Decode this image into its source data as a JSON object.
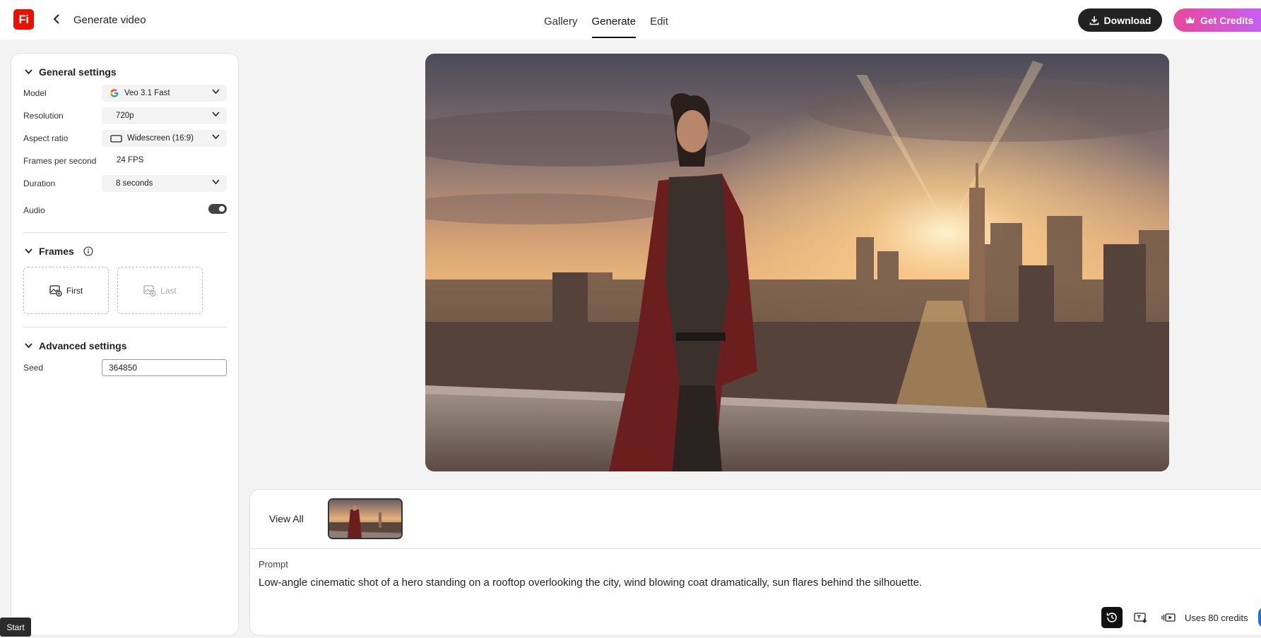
{
  "header": {
    "logo_text": "Fi",
    "page_title": "Generate video",
    "tabs": [
      {
        "label": "Gallery"
      },
      {
        "label": "Generate"
      },
      {
        "label": "Edit"
      }
    ],
    "download_label": "Download",
    "credits_label": "Get Credits"
  },
  "general": {
    "title": "General settings",
    "model_label": "Model",
    "model_value": "Veo 3.1 Fast",
    "resolution_label": "Resolution",
    "resolution_value": "720p",
    "aspect_label": "Aspect ratio",
    "aspect_value": "Widescreen (16:9)",
    "fps_label": "Frames per second",
    "fps_value": "24 FPS",
    "duration_label": "Duration",
    "duration_value": "8 seconds",
    "audio_label": "Audio",
    "audio_on": true
  },
  "frames": {
    "title": "Frames",
    "first_label": "First",
    "last_label": "Last"
  },
  "advanced": {
    "title": "Advanced settings",
    "seed_label": "Seed",
    "seed_value": "364850"
  },
  "start_label": "Start",
  "bottom": {
    "view_all_label": "View All",
    "prompt_label": "Prompt",
    "prompt_text": "Low-angle cinematic shot of a hero standing on a rooftop overlooking the city, wind blowing coat dramatically, sun flares behind the silhouette.",
    "credits_text": "Uses 80 credits"
  },
  "colors": {
    "brand_red": "#eb1000",
    "accent_pink": "#e8479b",
    "accent_purple": "#c65ff0",
    "accent_blue": "#1473e6"
  }
}
